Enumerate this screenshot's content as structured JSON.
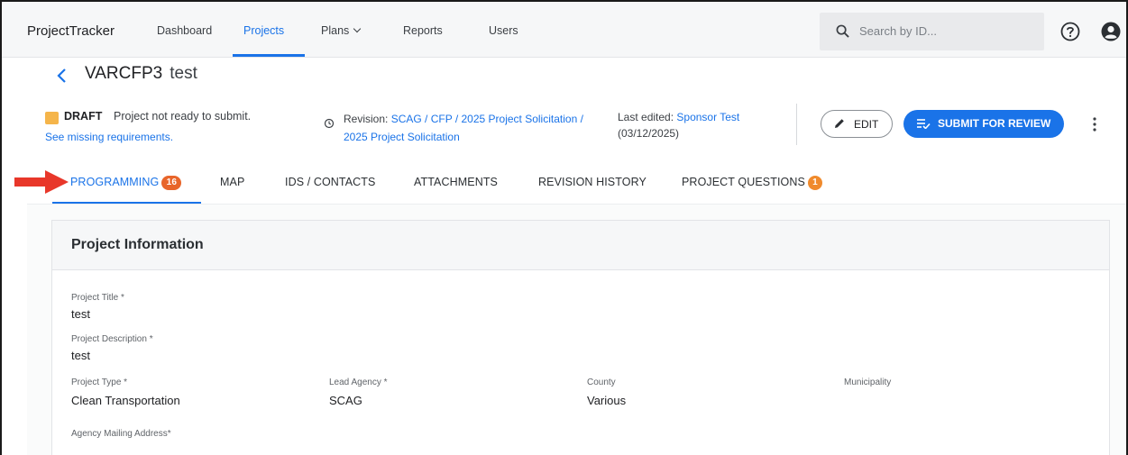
{
  "app": {
    "brand": "ProjectTracker",
    "nav": [
      {
        "label": "Dashboard",
        "active": false
      },
      {
        "label": "Projects",
        "active": true
      },
      {
        "label": "Plans",
        "active": false,
        "dropdown": true
      },
      {
        "label": "Reports",
        "active": false
      },
      {
        "label": "Users",
        "active": false
      }
    ],
    "search": {
      "placeholder": "Search by ID...",
      "value": ""
    },
    "icons": {
      "help": "help-circle-icon",
      "account": "account-circle-icon"
    }
  },
  "project": {
    "code": "VARCFP3",
    "name": "test",
    "status": {
      "label": "DRAFT",
      "message": "Project not ready to submit.",
      "link": "See missing requirements.",
      "color": "#f5b54a"
    },
    "revision": {
      "prefix": "Revision:",
      "line1": "SCAG / CFP / 2025 Project Solicitation /",
      "line2": "2025 Project Solicitation"
    },
    "last_edited": {
      "prefix": "Last edited:",
      "by": "Sponsor Test",
      "date": "(03/12/2025)"
    },
    "actions": {
      "edit": "EDIT",
      "submit": "SUBMIT FOR REVIEW"
    }
  },
  "tabs": [
    {
      "label": "PROGRAMMING",
      "badge": "16",
      "active": true
    },
    {
      "label": "MAP"
    },
    {
      "label": "IDS / CONTACTS"
    },
    {
      "label": "ATTACHMENTS"
    },
    {
      "label": "REVISION HISTORY"
    },
    {
      "label": "PROJECT QUESTIONS",
      "badge": "1"
    }
  ],
  "card": {
    "title": "Project Information",
    "fields": {
      "title": {
        "label": "Project Title *",
        "value": "test"
      },
      "description": {
        "label": "Project Description *",
        "value": "test"
      },
      "type": {
        "label": "Project Type *",
        "value": "Clean Transportation"
      },
      "lead_agency": {
        "label": "Lead Agency *",
        "value": "SCAG"
      },
      "county": {
        "label": "County",
        "value": "Various"
      },
      "municipality": {
        "label": "Municipality",
        "value": ""
      },
      "mailing_address": {
        "label": "Agency Mailing Address*",
        "value": ""
      }
    }
  },
  "colors": {
    "accent": "#1a73e8",
    "badge": "#e8652a",
    "arrow": "#e8372a"
  }
}
